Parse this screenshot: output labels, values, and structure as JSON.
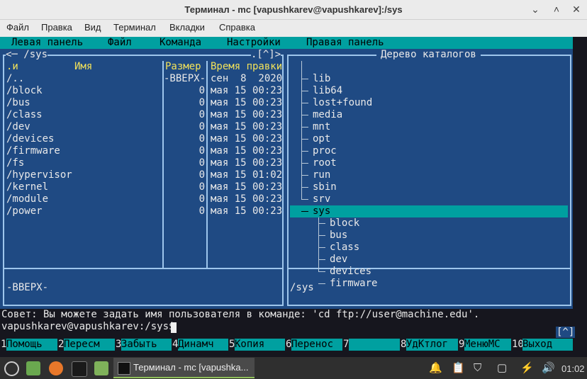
{
  "window": {
    "title": "Терминал - mc [vapushkarev@vapushkarev]:/sys",
    "minimize": "⌄",
    "maximize": "˄",
    "close": "✕"
  },
  "menubar": [
    "Файл",
    "Правка",
    "Вид",
    "Терминал",
    "Вкладки",
    "Справка"
  ],
  "mc_menu": [
    "Левая панель",
    "Файл",
    "Команда",
    "Настройки",
    "Правая панель"
  ],
  "left_panel": {
    "path_header": "<─ /sys",
    "header_right": ".[^]>",
    "col_name_sort": ".и",
    "col_name": "Имя",
    "col_size": "Размер",
    "col_time": "Время правки",
    "rows": [
      {
        "name": "/..",
        "size": "-ВВЕРХ-",
        "time": "сен  8  2020"
      },
      {
        "name": "/block",
        "size": "0",
        "time": "мая 15 00:23"
      },
      {
        "name": "/bus",
        "size": "0",
        "time": "мая 15 00:23"
      },
      {
        "name": "/class",
        "size": "0",
        "time": "мая 15 00:23"
      },
      {
        "name": "/dev",
        "size": "0",
        "time": "мая 15 00:23"
      },
      {
        "name": "/devices",
        "size": "0",
        "time": "мая 15 00:23"
      },
      {
        "name": "/firmware",
        "size": "0",
        "time": "мая 15 00:23"
      },
      {
        "name": "/fs",
        "size": "0",
        "time": "мая 15 00:23"
      },
      {
        "name": "/hypervisor",
        "size": "0",
        "time": "мая 15 01:02"
      },
      {
        "name": "/kernel",
        "size": "0",
        "time": "мая 15 00:23"
      },
      {
        "name": "/module",
        "size": "0",
        "time": "мая 15 00:23"
      },
      {
        "name": "/power",
        "size": "0",
        "time": "мая 15 00:23"
      }
    ],
    "status": "-ВВЕРХ-"
  },
  "right_panel": {
    "title": "Дерево каталогов",
    "items": [
      {
        "name": "lib",
        "level": 1
      },
      {
        "name": "lib64",
        "level": 1
      },
      {
        "name": "lost+found",
        "level": 1
      },
      {
        "name": "media",
        "level": 1
      },
      {
        "name": "mnt",
        "level": 1
      },
      {
        "name": "opt",
        "level": 1
      },
      {
        "name": "proc",
        "level": 1
      },
      {
        "name": "root",
        "level": 1
      },
      {
        "name": "run",
        "level": 1
      },
      {
        "name": "sbin",
        "level": 1
      },
      {
        "name": "srv",
        "level": 1
      },
      {
        "name": "sys",
        "level": 1,
        "selected": true
      },
      {
        "name": "block",
        "level": 2
      },
      {
        "name": "bus",
        "level": 2
      },
      {
        "name": "class",
        "level": 2
      },
      {
        "name": "dev",
        "level": 2
      },
      {
        "name": "devices",
        "level": 2
      },
      {
        "name": "firmware",
        "level": 2
      }
    ],
    "status": "/sys"
  },
  "hint": "Совет: Вы можете задать имя пользователя в команде: 'cd ftp://user@machine.edu'.",
  "prompt": "vapushkarev@vapushkarev:/sys$",
  "history_button": "[^]",
  "fkeys": [
    {
      "n": "1",
      "label": "Помощь"
    },
    {
      "n": "2",
      "label": "Пересм"
    },
    {
      "n": "3",
      "label": "Забыть"
    },
    {
      "n": "4",
      "label": "Динамч"
    },
    {
      "n": "5",
      "label": "Копия"
    },
    {
      "n": "6",
      "label": "Перенос"
    },
    {
      "n": "7",
      "label": ""
    },
    {
      "n": "8",
      "label": "УдКтлог"
    },
    {
      "n": "9",
      "label": "МенюMC"
    },
    {
      "n": "10",
      "label": "Выход"
    }
  ],
  "taskbar": {
    "window_label": "Терминал - mc [vapushka...",
    "clock": "01:02",
    "icons": [
      "mint-menu-icon",
      "show-desktop-icon",
      "firefox-icon",
      "terminal-icon",
      "files-icon"
    ],
    "tray": [
      "notifications-icon",
      "clipboard-icon",
      "shield-icon",
      "window-icon",
      "power-icon",
      "volume-icon"
    ]
  },
  "colors": {
    "panel_bg": "#1f4a83",
    "accent_cyan": "#00a0a0",
    "header_yellow": "#f2e25a",
    "frame": "#9ec6ec"
  }
}
